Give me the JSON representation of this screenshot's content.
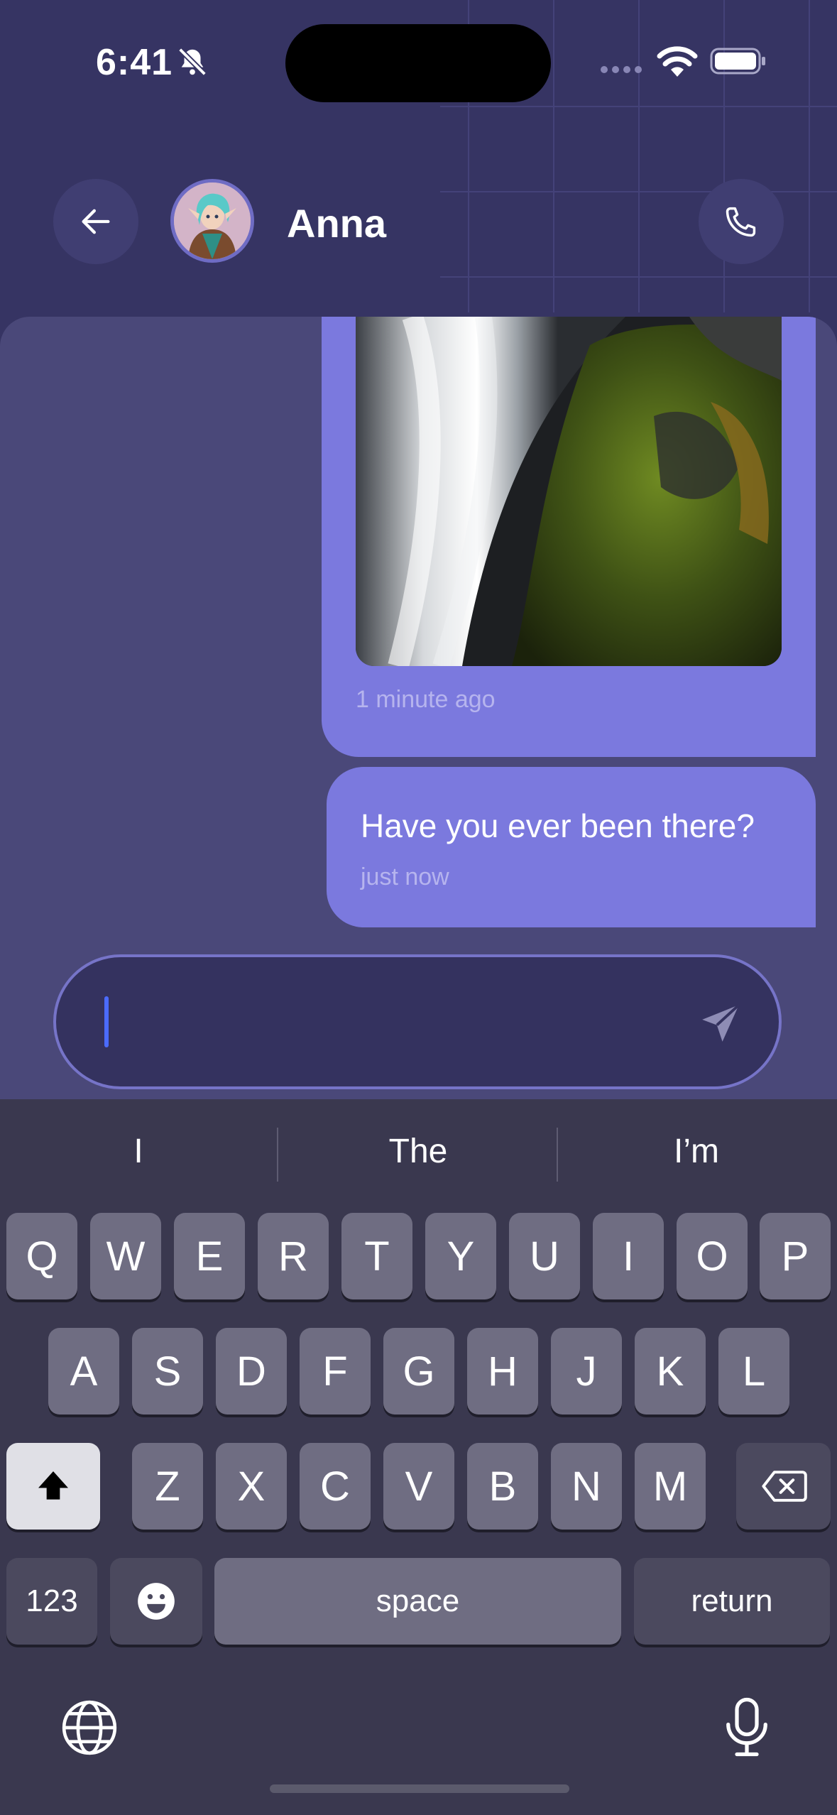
{
  "status_bar": {
    "time": "6:41",
    "icons": [
      "bell-slash-icon",
      "signal-icon",
      "wifi-icon",
      "battery-icon"
    ]
  },
  "header": {
    "contact_name": "Anna",
    "back_icon": "arrow-left-icon",
    "call_icon": "phone-icon"
  },
  "messages": [
    {
      "type": "image",
      "time": "1 minute ago"
    },
    {
      "type": "text",
      "text": "Have you ever been there?",
      "time": "just now"
    }
  ],
  "composer": {
    "value": "",
    "send_icon": "send-icon"
  },
  "keyboard": {
    "suggestions": [
      "I",
      "The",
      "I’m"
    ],
    "row1": [
      "Q",
      "W",
      "E",
      "R",
      "T",
      "Y",
      "U",
      "I",
      "O",
      "P"
    ],
    "row2": [
      "A",
      "S",
      "D",
      "F",
      "G",
      "H",
      "J",
      "K",
      "L"
    ],
    "row3": [
      "Z",
      "X",
      "C",
      "V",
      "B",
      "N",
      "M"
    ],
    "numbers_label": "123",
    "space_label": "space",
    "return_label": "return"
  },
  "colors": {
    "background": "#363463",
    "bubble": "#7b79de",
    "panel": "#4a4879",
    "caret": "#4b6bff"
  }
}
